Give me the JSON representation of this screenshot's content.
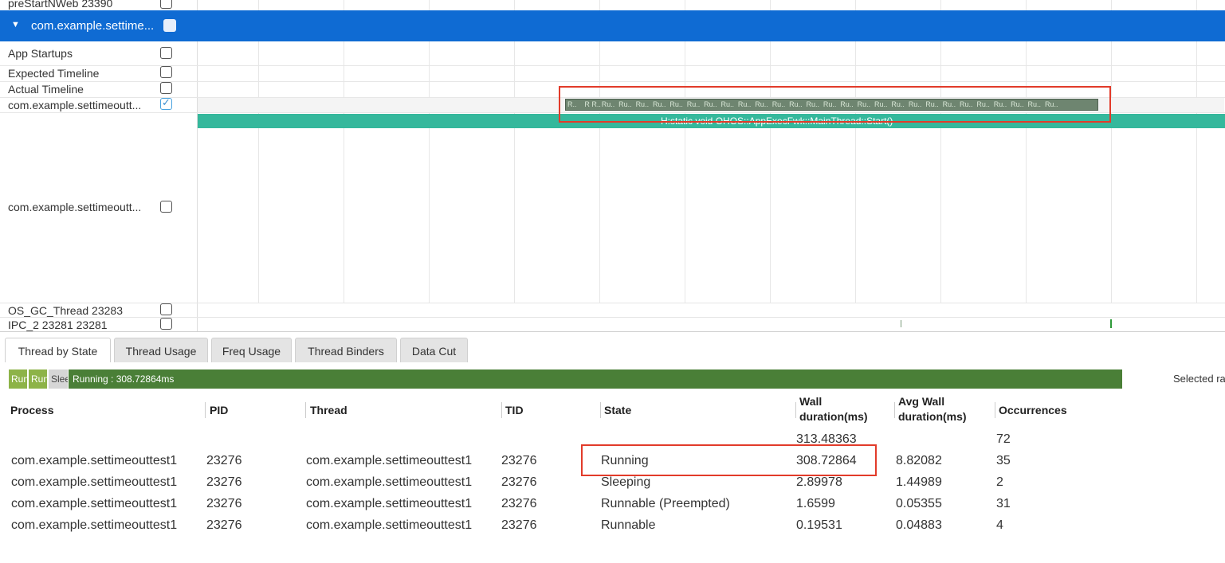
{
  "tracks": {
    "top_partial": "preStartNWeb 23390",
    "process_header": "com.example.settime...",
    "rows": [
      {
        "label": "App Startups",
        "checked": false
      },
      {
        "label": "Expected Timeline",
        "checked": false
      },
      {
        "label": "Actual Timeline",
        "checked": false
      },
      {
        "label": "com.example.settimeoutt...",
        "checked": true
      },
      {
        "label": "com.example.settimeoutt...",
        "checked": false
      },
      {
        "label": "OS_GC_Thread 23283",
        "checked": false
      },
      {
        "label": "IPC_2 23281 23281",
        "checked": false
      }
    ],
    "run_slice_labels": [
      "R..",
      "R R..",
      "Ru..",
      "Ru..",
      "Ru..",
      "Ru..",
      "Ru..",
      "Ru..",
      "Ru..",
      "Ru..",
      "Ru..",
      "Ru..",
      "Ru..",
      "Ru..",
      "Ru..",
      "Ru..",
      "Ru..",
      "Ru..",
      "Ru..",
      "Ru..",
      "Ru..",
      "Ru..",
      "Ru..",
      "Ru..",
      "Ru..",
      "Ru..",
      "Ru..",
      "Ru..",
      "Ru.."
    ],
    "func_slice_label": "H:static void OHOS::AppExecFwk::MainThread::Start()"
  },
  "tabs": [
    "Thread by State",
    "Thread Usage",
    "Freq Usage",
    "Thread Binders",
    "Data Cut"
  ],
  "summary_bar": {
    "chips": [
      "Run",
      "Run",
      "Slee"
    ],
    "running_label": "Running : 308.72864ms",
    "selected_text": "Selected ra"
  },
  "table": {
    "headers": {
      "process": "Process",
      "pid": "PID",
      "thread": "Thread",
      "tid": "TID",
      "state": "State",
      "wall_1": "Wall",
      "wall_2": "duration(ms)",
      "avg_1": "Avg Wall",
      "avg_2": "duration(ms)",
      "occurrences": "Occurrences"
    },
    "total": {
      "wall": "313.48363",
      "occurrences": "72"
    },
    "rows": [
      {
        "process": "com.example.settimeouttest1",
        "pid": "23276",
        "thread": "com.example.settimeouttest1",
        "tid": "23276",
        "state": "Running",
        "wall": "308.72864",
        "avg": "8.82082",
        "occ": "35"
      },
      {
        "process": "com.example.settimeouttest1",
        "pid": "23276",
        "thread": "com.example.settimeouttest1",
        "tid": "23276",
        "state": "Sleeping",
        "wall": "2.89978",
        "avg": "1.44989",
        "occ": "2"
      },
      {
        "process": "com.example.settimeouttest1",
        "pid": "23276",
        "thread": "com.example.settimeouttest1",
        "tid": "23276",
        "state": "Runnable (Preempted)",
        "wall": "1.6599",
        "avg": "0.05355",
        "occ": "31"
      },
      {
        "process": "com.example.settimeouttest1",
        "pid": "23276",
        "thread": "com.example.settimeouttest1",
        "tid": "23276",
        "state": "Runnable",
        "wall": "0.19531",
        "avg": "0.04883",
        "occ": "4"
      }
    ]
  },
  "colors": {
    "header_blue": "#0f6bd3",
    "func_teal": "#35b89c",
    "running_green": "#4a7f37",
    "highlight_red": "#e23b2a"
  }
}
